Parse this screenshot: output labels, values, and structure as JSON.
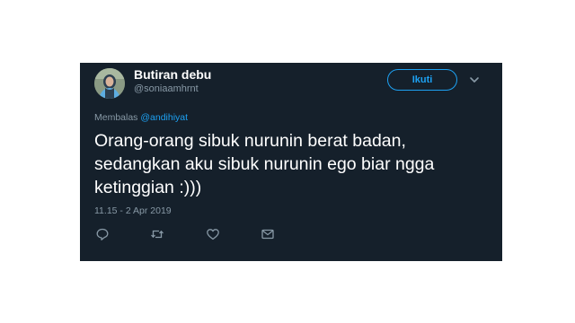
{
  "tweet": {
    "author": {
      "display_name": "Butiran debu",
      "handle": "@soniaamhrnt"
    },
    "follow_label": "Ikuti",
    "reply_prefix": "Membalas",
    "reply_to": "@andihiyat",
    "text_lines": [
      "Orang-orang sibuk nurunin berat badan,",
      "sedangkan aku sibuk nurunin ego biar ngga",
      "ketinggian :)))"
    ],
    "timestamp": "11.15 - 2 Apr 2019",
    "actions": [
      "reply-icon",
      "retweet-icon",
      "like-icon",
      "message-icon"
    ]
  },
  "colors": {
    "background": "#15202b",
    "accent": "#1da1f2",
    "secondary_text": "#8899a6",
    "primary_text": "#ffffff"
  }
}
